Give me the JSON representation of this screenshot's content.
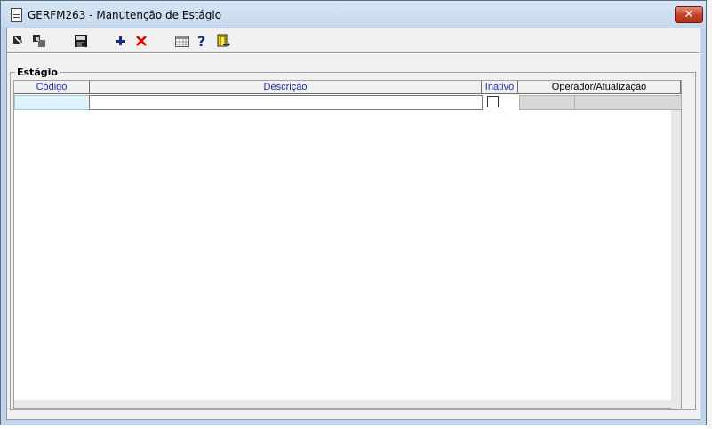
{
  "window": {
    "title": "GERFM263 - Manutenção de Estágio",
    "close_label": "✕"
  },
  "toolbar": {
    "icons": [
      "first-record-icon",
      "last-record-icon",
      "save-icon",
      "add-icon",
      "delete-icon",
      "calendar-grid-icon",
      "help-icon",
      "exit-door-icon"
    ]
  },
  "section": {
    "legend": "Estágio"
  },
  "grid": {
    "columns": [
      "Código",
      "Descrição",
      "Inativo",
      "Operador/Atualização"
    ],
    "row": {
      "codigo": "",
      "descricao": "",
      "inativo": false,
      "operador": "",
      "atualizacao": ""
    }
  },
  "colors": {
    "title_bg": "#c5d9ee",
    "header_text_blue": "#1f2ea8",
    "selected_cell": "#dff3fc",
    "close_btn": "#c2402a",
    "add_icon": "#1c2b7a",
    "delete_icon": "#e00000"
  }
}
